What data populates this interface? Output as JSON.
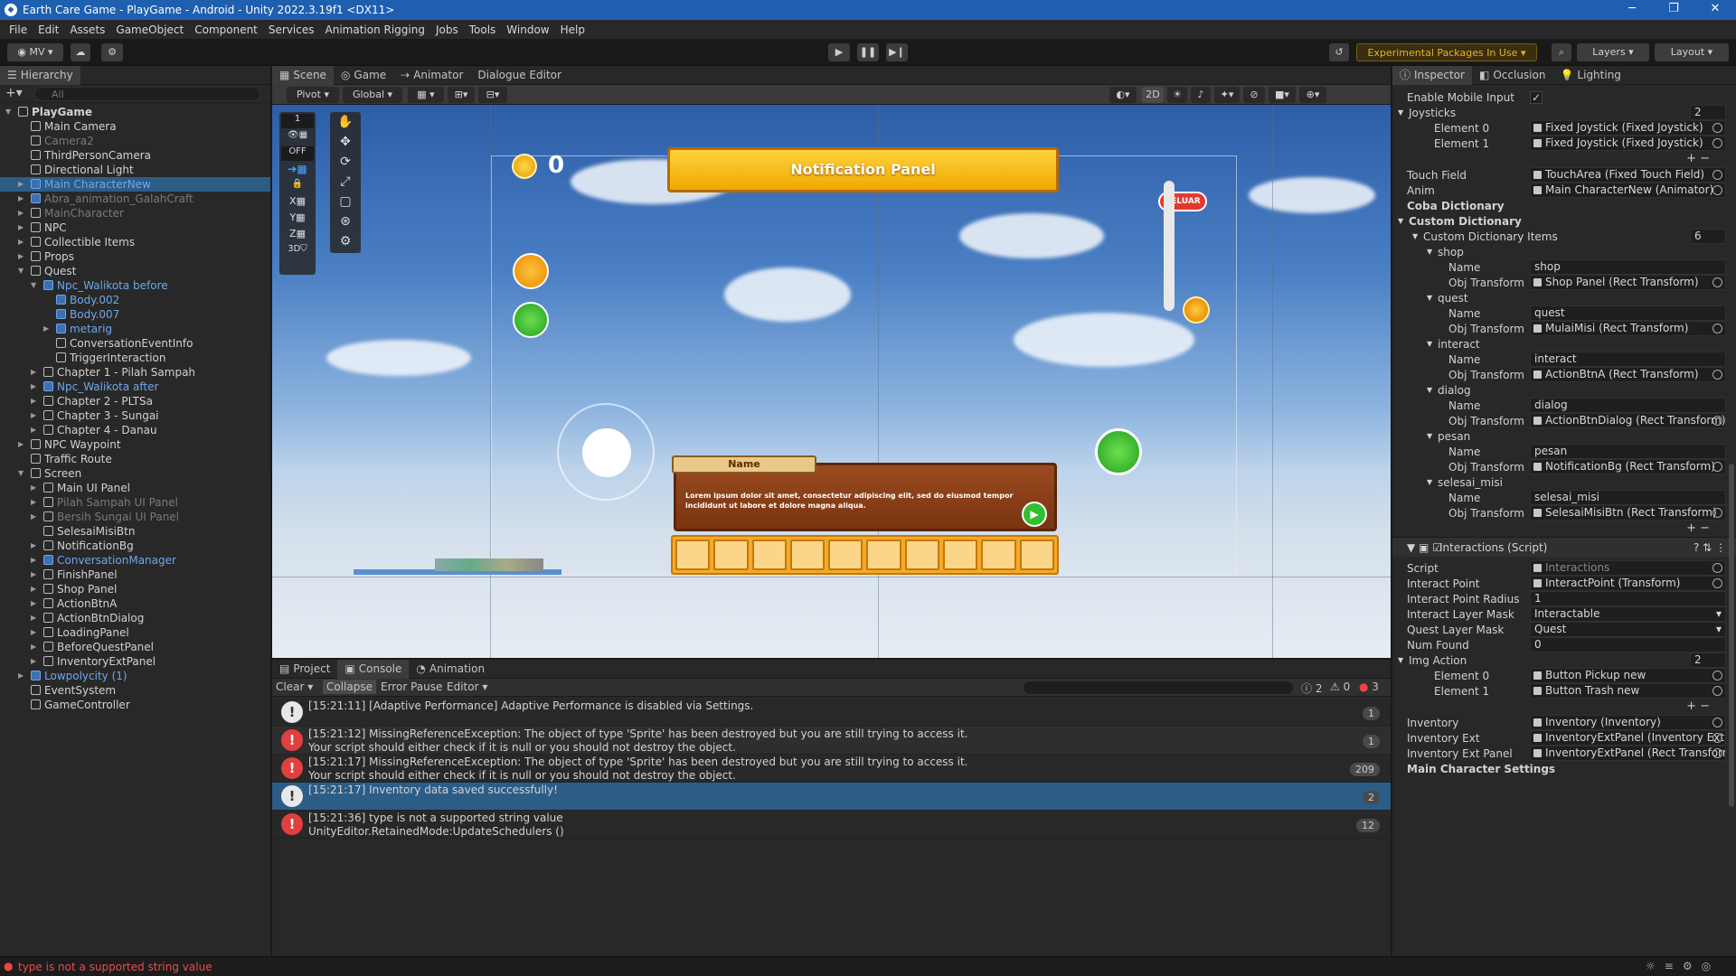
{
  "window": {
    "title": "Earth Care Game - PlayGame - Android - Unity 2022.3.19f1 <DX11>"
  },
  "menu": [
    "File",
    "Edit",
    "Assets",
    "GameObject",
    "Component",
    "Services",
    "Animation Rigging",
    "Jobs",
    "Tools",
    "Window",
    "Help"
  ],
  "toolbar": {
    "account": "MV",
    "packages": "Experimental Packages In Use",
    "layers": "Layers",
    "layout": "Layout"
  },
  "hierarchy": {
    "title": "Hierarchy",
    "search_placeholder": "All",
    "items": [
      {
        "label": "PlayGame",
        "depth": 0,
        "arrow": "▼",
        "kind": "scene"
      },
      {
        "label": "Main Camera",
        "depth": 1,
        "arrow": "",
        "kind": "normal"
      },
      {
        "label": "Camera2",
        "depth": 1,
        "arrow": "",
        "kind": "dis"
      },
      {
        "label": "ThirdPersonCamera",
        "depth": 1,
        "arrow": "",
        "kind": "normal"
      },
      {
        "label": "Directional Light",
        "depth": 1,
        "arrow": "",
        "kind": "normal"
      },
      {
        "label": "Main CharacterNew",
        "depth": 1,
        "arrow": "▶",
        "kind": "prefab sel"
      },
      {
        "label": "Abra_animation_GalahCraft",
        "depth": 1,
        "arrow": "▶",
        "kind": "prefab dis"
      },
      {
        "label": "MainCharacter",
        "depth": 1,
        "arrow": "▶",
        "kind": "dis"
      },
      {
        "label": "NPC",
        "depth": 1,
        "arrow": "▶",
        "kind": "normal"
      },
      {
        "label": "Collectible Items",
        "depth": 1,
        "arrow": "▶",
        "kind": "normal"
      },
      {
        "label": "Props",
        "depth": 1,
        "arrow": "▶",
        "kind": "normal"
      },
      {
        "label": "Quest",
        "depth": 1,
        "arrow": "▼",
        "kind": "normal"
      },
      {
        "label": "Npc_Walikota before",
        "depth": 2,
        "arrow": "▼",
        "kind": "prefab"
      },
      {
        "label": "Body.002",
        "depth": 3,
        "arrow": "",
        "kind": "prefab"
      },
      {
        "label": "Body.007",
        "depth": 3,
        "arrow": "",
        "kind": "prefab"
      },
      {
        "label": "metarig",
        "depth": 3,
        "arrow": "▶",
        "kind": "prefab"
      },
      {
        "label": "ConversationEventInfo",
        "depth": 3,
        "arrow": "",
        "kind": "normal"
      },
      {
        "label": "TriggerInteraction",
        "depth": 3,
        "arrow": "",
        "kind": "normal"
      },
      {
        "label": "Chapter 1 - Pilah Sampah",
        "depth": 2,
        "arrow": "▶",
        "kind": "normal"
      },
      {
        "label": "Npc_Walikota after",
        "depth": 2,
        "arrow": "▶",
        "kind": "prefab"
      },
      {
        "label": "Chapter 2 - PLTSa",
        "depth": 2,
        "arrow": "▶",
        "kind": "normal"
      },
      {
        "label": "Chapter 3 - Sungai",
        "depth": 2,
        "arrow": "▶",
        "kind": "normal"
      },
      {
        "label": "Chapter 4 - Danau",
        "depth": 2,
        "arrow": "▶",
        "kind": "normal"
      },
      {
        "label": "NPC Waypoint",
        "depth": 1,
        "arrow": "▶",
        "kind": "normal"
      },
      {
        "label": "Traffic Route",
        "depth": 1,
        "arrow": "",
        "kind": "normal"
      },
      {
        "label": "Screen",
        "depth": 1,
        "arrow": "▼",
        "kind": "normal"
      },
      {
        "label": "Main UI Panel",
        "depth": 2,
        "arrow": "▶",
        "kind": "normal"
      },
      {
        "label": "Pilah Sampah UI Panel",
        "depth": 2,
        "arrow": "▶",
        "kind": "dis"
      },
      {
        "label": "Bersih Sungai UI Panel",
        "depth": 2,
        "arrow": "▶",
        "kind": "dis"
      },
      {
        "label": "SelesaiMisiBtn",
        "depth": 2,
        "arrow": "",
        "kind": "normal"
      },
      {
        "label": "NotificationBg",
        "depth": 2,
        "arrow": "▶",
        "kind": "normal"
      },
      {
        "label": "ConversationManager",
        "depth": 2,
        "arrow": "▶",
        "kind": "prefab"
      },
      {
        "label": "FinishPanel",
        "depth": 2,
        "arrow": "▶",
        "kind": "normal"
      },
      {
        "label": "Shop Panel",
        "depth": 2,
        "arrow": "▶",
        "kind": "normal"
      },
      {
        "label": "ActionBtnA",
        "depth": 2,
        "arrow": "▶",
        "kind": "normal"
      },
      {
        "label": "ActionBtnDialog",
        "depth": 2,
        "arrow": "▶",
        "kind": "normal"
      },
      {
        "label": "LoadingPanel",
        "depth": 2,
        "arrow": "▶",
        "kind": "normal"
      },
      {
        "label": "BeforeQuestPanel",
        "depth": 2,
        "arrow": "▶",
        "kind": "normal"
      },
      {
        "label": "InventoryExtPanel",
        "depth": 2,
        "arrow": "▶",
        "kind": "normal"
      },
      {
        "label": "Lowpolycity (1)",
        "depth": 1,
        "arrow": "▶",
        "kind": "prefab"
      },
      {
        "label": "EventSystem",
        "depth": 1,
        "arrow": "",
        "kind": "normal"
      },
      {
        "label": "GameController",
        "depth": 1,
        "arrow": "",
        "kind": "normal"
      }
    ]
  },
  "scene": {
    "tabs": [
      "Scene",
      "Game",
      "Animator",
      "Dialogue Editor"
    ],
    "pivot": "Pivot",
    "global": "Global",
    "mode_2d": "2D",
    "grid_off": "OFF",
    "layer_1": "1",
    "hud": {
      "coins": "0",
      "notification": "Notification Panel",
      "exit": "KELUAR",
      "name_tag": "Name",
      "dialog_text": "Lorem ipsum dolor sit amet, consectetur adipiscing elit, sed do eiusmod tempor incididunt ut labore et dolore magna aliqua."
    }
  },
  "console": {
    "tabs": [
      "Project",
      "Console",
      "Animation"
    ],
    "buttons": [
      "Clear",
      "Collapse",
      "Error Pause",
      "Editor"
    ],
    "counts": {
      "info": "2",
      "warn": "0",
      "error": "3"
    },
    "entries": [
      {
        "type": "info",
        "text": "[15:21:11] [Adaptive Performance] Adaptive Performance is disabled via Settings.",
        "count": "1"
      },
      {
        "type": "error",
        "text": "[15:21:12] MissingReferenceException: The object of type 'Sprite' has been destroyed but you are still trying to access it.\nYour script should either check if it is null or you should not destroy the object.",
        "count": "1"
      },
      {
        "type": "error",
        "text": "[15:21:17] MissingReferenceException: The object of type 'Sprite' has been destroyed but you are still trying to access it.\nYour script should either check if it is null or you should not destroy the object.",
        "count": "209"
      },
      {
        "type": "info",
        "text": "[15:21:17] Inventory data saved successfully!",
        "count": "2"
      },
      {
        "type": "error",
        "text": "[15:21:36] type is not a supported string value\nUnityEditor.RetainedMode:UpdateSchedulers ()",
        "count": "12"
      }
    ]
  },
  "inspector": {
    "tabs": [
      "Inspector",
      "Occlusion",
      "Lighting"
    ],
    "rows": [
      {
        "k": "Enable Mobile Input",
        "v": "✓",
        "kind": "check",
        "x": 16
      },
      {
        "k": "Joysticks",
        "v": "2",
        "kind": "count",
        "x": 6,
        "arrow": "▼"
      },
      {
        "k": "Element 0",
        "v": "Fixed Joystick (Fixed Joystick)",
        "kind": "ref",
        "x": 46
      },
      {
        "k": "Element 1",
        "v": "Fixed Joystick (Fixed Joystick)",
        "kind": "ref",
        "x": 46
      },
      {
        "k": "",
        "v": "",
        "kind": "pm"
      },
      {
        "k": "Touch Field",
        "v": "TouchArea (Fixed Touch Field)",
        "kind": "ref",
        "x": 16
      },
      {
        "k": "Anim",
        "v": "Main CharacterNew (Animator)",
        "kind": "ref",
        "x": 16
      },
      {
        "k": "Coba Dictionary",
        "v": "",
        "kind": "label",
        "x": 16
      },
      {
        "k": "Custom Dictionary",
        "v": "",
        "kind": "label",
        "x": 6,
        "arrow": "▼"
      },
      {
        "k": "Custom Dictionary Items",
        "v": "6",
        "kind": "count",
        "x": 22,
        "arrow": "▼"
      },
      {
        "k": "shop",
        "v": "",
        "kind": "label",
        "x": 38,
        "arrow": "▼"
      },
      {
        "k": "Name",
        "v": "shop",
        "kind": "text",
        "x": 62
      },
      {
        "k": "Obj Transform",
        "v": "Shop Panel (Rect Transform)",
        "kind": "ref",
        "x": 62
      },
      {
        "k": "quest",
        "v": "",
        "kind": "label",
        "x": 38,
        "arrow": "▼"
      },
      {
        "k": "Name",
        "v": "quest",
        "kind": "text",
        "x": 62
      },
      {
        "k": "Obj Transform",
        "v": "MulaiMisi (Rect Transform)",
        "kind": "ref",
        "x": 62
      },
      {
        "k": "interact",
        "v": "",
        "kind": "label",
        "x": 38,
        "arrow": "▼"
      },
      {
        "k": "Name",
        "v": "interact",
        "kind": "text",
        "x": 62
      },
      {
        "k": "Obj Transform",
        "v": "ActionBtnA (Rect Transform)",
        "kind": "ref",
        "x": 62
      },
      {
        "k": "dialog",
        "v": "",
        "kind": "label",
        "x": 38,
        "arrow": "▼"
      },
      {
        "k": "Name",
        "v": "dialog",
        "kind": "text",
        "x": 62
      },
      {
        "k": "Obj Transform",
        "v": "ActionBtnDialog (Rect Transform)",
        "kind": "ref",
        "x": 62
      },
      {
        "k": "pesan",
        "v": "",
        "kind": "label",
        "x": 38,
        "arrow": "▼"
      },
      {
        "k": "Name",
        "v": "pesan",
        "kind": "text",
        "x": 62
      },
      {
        "k": "Obj Transform",
        "v": "NotificationBg (Rect Transform)",
        "kind": "ref",
        "x": 62
      },
      {
        "k": "selesai_misi",
        "v": "",
        "kind": "label",
        "x": 38,
        "arrow": "▼"
      },
      {
        "k": "Name",
        "v": "selesai_misi",
        "kind": "text",
        "x": 62
      },
      {
        "k": "Obj Transform",
        "v": "SelesaiMisiBtn (Rect Transform)",
        "kind": "ref",
        "x": 62
      },
      {
        "k": "",
        "v": "",
        "kind": "pm"
      },
      {
        "k": "Interactions (Script)",
        "v": "",
        "kind": "component",
        "x": 52
      },
      {
        "k": "Script",
        "v": "Interactions",
        "kind": "refdim",
        "x": 16
      },
      {
        "k": "Interact Point",
        "v": "InteractPoint (Transform)",
        "kind": "ref",
        "x": 16
      },
      {
        "k": "Interact Point Radius",
        "v": "1",
        "kind": "text",
        "x": 16
      },
      {
        "k": "Interact Layer Mask",
        "v": "Interactable",
        "kind": "dropdown",
        "x": 16
      },
      {
        "k": "Quest Layer Mask",
        "v": "Quest",
        "kind": "dropdown",
        "x": 16
      },
      {
        "k": "Num Found",
        "v": "0",
        "kind": "text",
        "x": 16
      },
      {
        "k": "Img Action",
        "v": "2",
        "kind": "count",
        "x": 6,
        "arrow": "▼"
      },
      {
        "k": "Element 0",
        "v": "Button Pickup new",
        "kind": "ref",
        "x": 46
      },
      {
        "k": "Element 1",
        "v": "Button Trash new",
        "kind": "ref",
        "x": 46
      },
      {
        "k": "",
        "v": "",
        "kind": "pm"
      },
      {
        "k": "Inventory",
        "v": "Inventory (Inventory)",
        "kind": "ref",
        "x": 16
      },
      {
        "k": "Inventory Ext",
        "v": "InventoryExtPanel (Inventory Ext)",
        "kind": "ref",
        "x": 16
      },
      {
        "k": "Inventory Ext Panel",
        "v": "InventoryExtPanel (Rect Transform)",
        "kind": "ref",
        "x": 16
      },
      {
        "k": "Main Character Settings",
        "v": "",
        "kind": "label",
        "x": 16
      }
    ]
  },
  "status": {
    "message": "type is not a supported string value"
  }
}
